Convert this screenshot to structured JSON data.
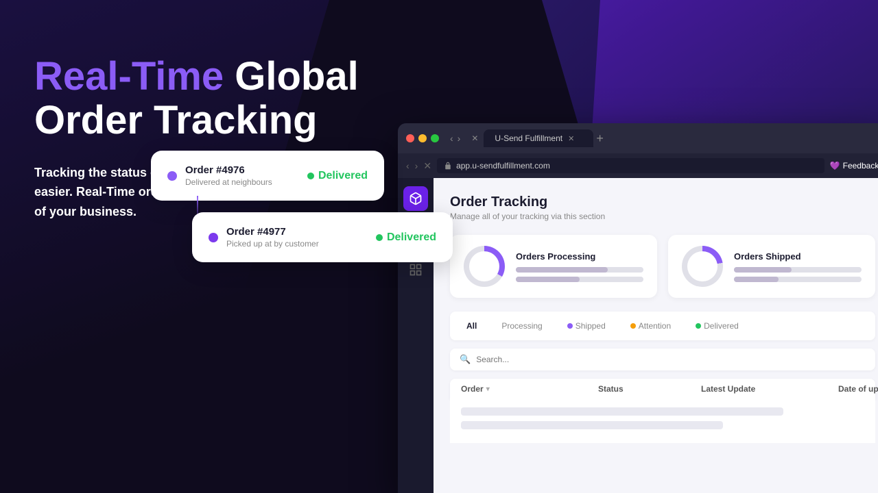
{
  "background": {
    "color": "#0f0b1e"
  },
  "hero": {
    "headline_accent": "Real-Time",
    "headline_rest": " Global\nOrder Tracking",
    "subtext": "Tracking the status of your orders has never been easier. Real-Time order tracking keeps you on top of your business."
  },
  "browser": {
    "tab_title": "U-Send Fulfillment",
    "url": "app.u-sendfulfillment.com",
    "feedback_label": "Feedback?"
  },
  "app": {
    "section_title": "Order Tracking",
    "section_subtitle": "Manage all of your tracking via this section",
    "stats": [
      {
        "label": "Orders Processing",
        "bar1_width": "72%",
        "bar2_width": "50%"
      },
      {
        "label": "Orders Shipped",
        "bar1_width": "45%",
        "bar2_width": "35%"
      }
    ],
    "filter_tabs": [
      {
        "label": "All",
        "active": true,
        "dot": null
      },
      {
        "label": "Processing",
        "active": false,
        "dot": "purple"
      },
      {
        "label": "Shipped",
        "active": false,
        "dot": "purple"
      },
      {
        "label": "Attention",
        "active": false,
        "dot": "yellow"
      },
      {
        "label": "Delivered",
        "active": false,
        "dot": "green"
      }
    ],
    "table_headers": [
      "Order",
      "Status",
      "Latest Update",
      "Date of update"
    ]
  },
  "order_cards": [
    {
      "order_number": "Order #4976",
      "sub": "Delivered at neighbours",
      "status": "Delivered"
    },
    {
      "order_number": "Order #4977",
      "sub": "Picked up at by customer",
      "status": "Delivered"
    }
  ]
}
